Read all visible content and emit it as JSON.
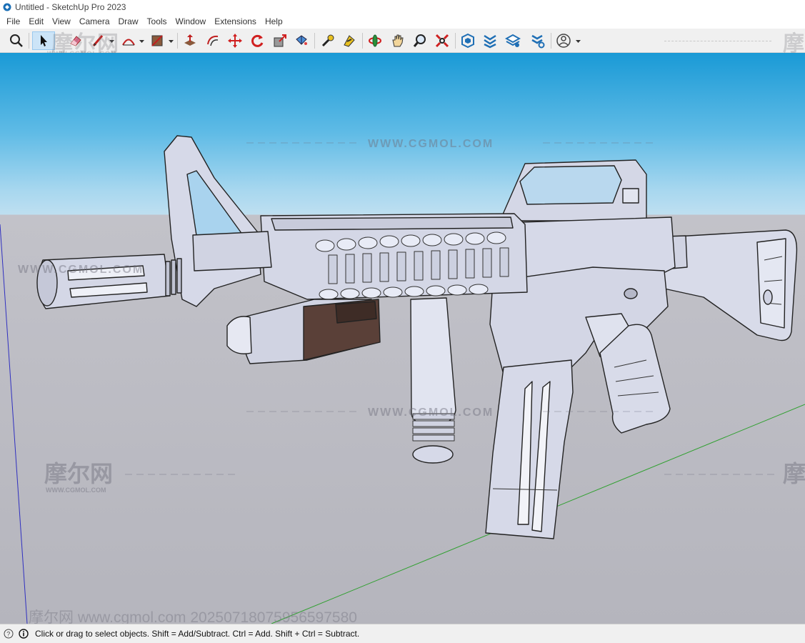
{
  "window": {
    "title": "Untitled - SketchUp Pro 2023",
    "app_icon": "sketchup-logo-icon"
  },
  "menu": {
    "items": [
      "File",
      "Edit",
      "View",
      "Camera",
      "Draw",
      "Tools",
      "Window",
      "Extensions",
      "Help"
    ]
  },
  "toolbar": {
    "tools": [
      {
        "name": "zoom-extents-icon"
      },
      {
        "name": "select-icon",
        "active": true
      },
      {
        "name": "eraser-icon"
      },
      {
        "name": "pencil-line-icon"
      },
      {
        "name": "arc-icon"
      },
      {
        "name": "rectangle-icon"
      },
      {
        "name": "push-pull-icon"
      },
      {
        "name": "offset-icon"
      },
      {
        "name": "move-icon"
      },
      {
        "name": "rotate-icon"
      },
      {
        "name": "scale-icon"
      },
      {
        "name": "paint-bucket-icon"
      },
      {
        "name": "tape-measure-icon"
      },
      {
        "name": "text-label-icon"
      },
      {
        "name": "orbit-icon"
      },
      {
        "name": "pan-icon"
      },
      {
        "name": "zoom-icon"
      },
      {
        "name": "zoom-window-icon"
      },
      {
        "name": "warehouse-icon"
      },
      {
        "name": "extension-warehouse-icon"
      },
      {
        "name": "layers-icon"
      },
      {
        "name": "extension-manager-icon"
      },
      {
        "name": "account-icon"
      }
    ]
  },
  "watermarks": {
    "cn": "摩尔网",
    "site": "WWW.CGMOL.COM",
    "site_small": "www.cgmol.com"
  },
  "overlay": {
    "url_text": "摩尔网 www.cgmol.com 2025071807595659758​0"
  },
  "status": {
    "text": "Click or drag to select objects. Shift = Add/Subtract. Ctrl = Add. Shift + Ctrl = Subtract."
  },
  "colors": {
    "sky_top": "#1a9ad6",
    "ground": "#b8b8c0",
    "model_fill": "#d8dbe9",
    "accent_brown": "#5a4038"
  }
}
